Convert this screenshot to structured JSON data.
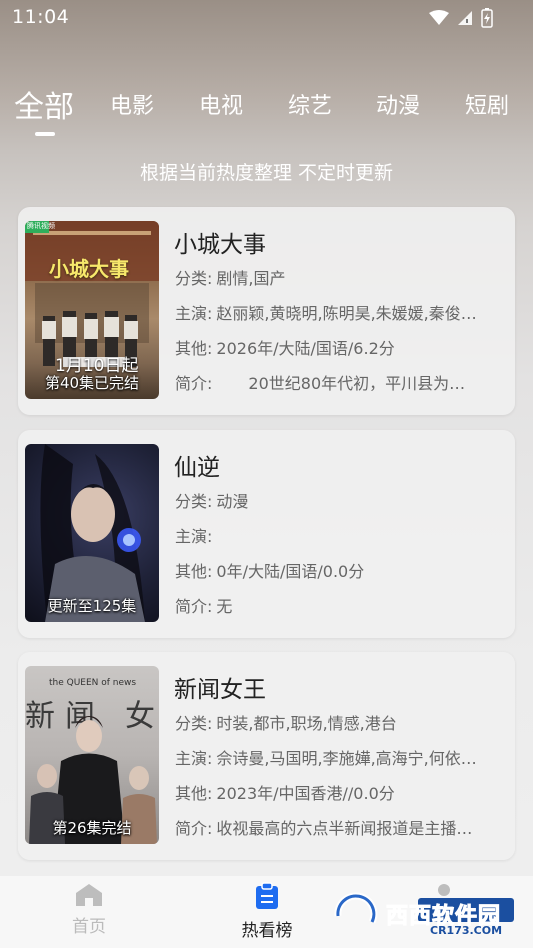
{
  "status": {
    "time": "11:04"
  },
  "tabs": [
    {
      "label": "全部",
      "active": true
    },
    {
      "label": "电影"
    },
    {
      "label": "电视"
    },
    {
      "label": "综艺"
    },
    {
      "label": "动漫"
    },
    {
      "label": "短剧"
    }
  ],
  "subtitle": "根据当前热度整理 不定时更新",
  "cards": [
    {
      "title": "小城大事",
      "badge": "第40集已完结",
      "poster_text": "小城大事",
      "poster_date": "1月10日起",
      "poster_tag": "腾讯视频",
      "category_label": "分类:",
      "category": "剧情,国产",
      "cast_label": "主演:",
      "cast": "赵丽颖,黄晓明,陈明昊,朱媛媛,秦俊…",
      "other_label": "其他:",
      "other": "2026年/大陆/国语/6.2分",
      "intro_label": "简介:",
      "intro": "　　20世纪80年代初，平川县为…"
    },
    {
      "title": "仙逆",
      "badge": "更新至125集",
      "category_label": "分类:",
      "category": "动漫",
      "cast_label": "主演:",
      "cast": "",
      "other_label": "其他:",
      "other": "0年/大陆/国语/0.0分",
      "intro_label": "简介:",
      "intro": "无"
    },
    {
      "title": "新闻女王",
      "badge": "第26集完结",
      "poster_text": "the QUEEN of news",
      "category_label": "分类:",
      "category": "时装,都市,职场,情感,港台",
      "cast_label": "主演:",
      "cast": "佘诗曼,马国明,李施嬅,高海宁,何依…",
      "other_label": "其他:",
      "other": "2023年/中国香港//0.0分",
      "intro_label": "简介:",
      "intro": "收视最高的六点半新闻报道是主播…"
    }
  ],
  "nav": {
    "home": "首页",
    "hot": "热看榜"
  },
  "watermark": {
    "text": "西西软件园",
    "url_text": "CR173.COM"
  },
  "colors": {
    "accent": "#1e6cf0",
    "text": "#222222",
    "muted": "#666666"
  }
}
